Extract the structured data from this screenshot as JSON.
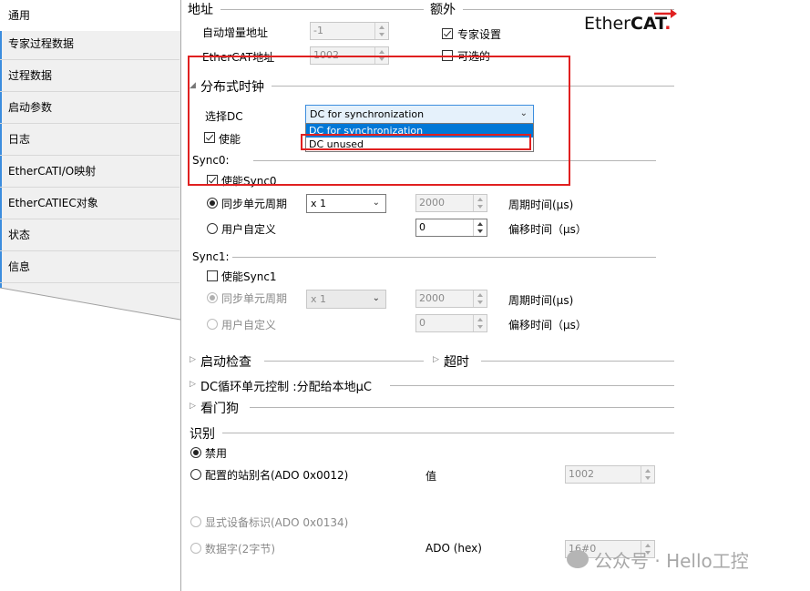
{
  "tabs": [
    {
      "label": "通用"
    },
    {
      "label": "专家过程数据"
    },
    {
      "label": "过程数据"
    },
    {
      "label": "启动参数"
    },
    {
      "label": "日志"
    },
    {
      "label": "EtherCATI/O映射"
    },
    {
      "label": "EtherCATIEC对象"
    },
    {
      "label": "状态"
    },
    {
      "label": "信息"
    }
  ],
  "address": {
    "header": "地址",
    "auto_inc_label": "自动增量地址",
    "auto_inc_value": "-1",
    "ethercat_addr_label": "EtherCAT地址",
    "ethercat_addr_value": "1002"
  },
  "extra": {
    "header": "额外",
    "expert_settings_label": "专家设置",
    "expert_settings_checked": true,
    "optional_label": "可选的",
    "optional_checked": false
  },
  "logo": {
    "text_plain": "Ether",
    "text_bold": "CAT",
    "suffix": "."
  },
  "dc": {
    "header": "分布式时钟",
    "select_label": "选择DC",
    "select_value": "DC for synchronization",
    "options": [
      "DC for synchronization",
      "DC unused"
    ],
    "highlighted_option": "DC unused",
    "enable_label": "使能",
    "enable_checked": true
  },
  "sync0": {
    "header": "Sync0:",
    "enable_label": "使能Sync0",
    "enable_checked": true,
    "sync_unit_label": "同步单元周期",
    "sync_unit_selected": true,
    "multiplier_value": "x 1",
    "cycle_value": "2000",
    "cycle_label": "周期时间(μs)",
    "user_defined_label": "用户自定义",
    "offset_value": "0",
    "offset_label": "偏移时间（μs）"
  },
  "sync1": {
    "header": "Sync1:",
    "enable_label": "使能Sync1",
    "enable_checked": false,
    "sync_unit_label": "同步单元周期",
    "multiplier_value": "x 1",
    "cycle_value": "2000",
    "cycle_label": "周期时间(μs)",
    "user_defined_label": "用户自定义",
    "offset_value": "0",
    "offset_label": "偏移时间（μs）"
  },
  "collapsed": {
    "startup_check": "启动检查",
    "timeout": "超时",
    "dc_cycle": "DC循环单元控制 :分配给本地μC",
    "watchdog": "看门狗"
  },
  "ident": {
    "header": "识别",
    "disabled_label": "禁用",
    "alias_label": "配置的站别名(ADO 0x0012)",
    "value_label": "值",
    "alias_value": "1002",
    "explicit_label": "显式设备标识(ADO 0x0134)",
    "dataword_label": "数据字(2字节)",
    "ado_hex_label": "ADO (hex)",
    "ado_hex_value": "16#0"
  },
  "watermark": {
    "text": "公众号 · Hello工控"
  }
}
